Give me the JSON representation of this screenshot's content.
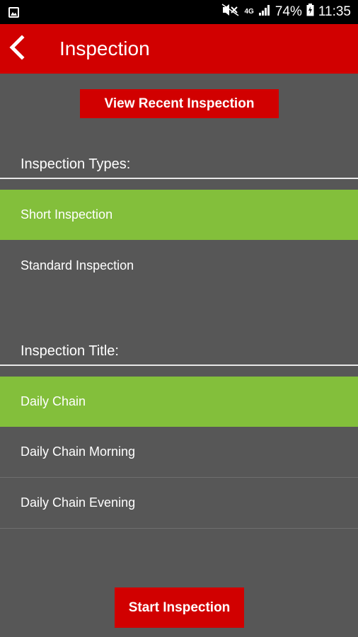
{
  "status_bar": {
    "network_label": "4G",
    "battery": "74%",
    "time": "11:35",
    "icons": [
      "gallery-notification-icon",
      "mute-icon",
      "signal-icon",
      "battery-icon"
    ]
  },
  "app_bar": {
    "title": "Inspection",
    "back_icon": "chevron-left-icon",
    "color": "#d10000"
  },
  "recent_button": {
    "label": "View Recent Inspection"
  },
  "inspection_types": {
    "label": "Inspection Types:",
    "items": [
      {
        "label": "Short Inspection",
        "selected": true
      },
      {
        "label": "Standard Inspection",
        "selected": false
      }
    ]
  },
  "inspection_titles": {
    "label": "Inspection Title:",
    "items": [
      {
        "label": "Daily Chain",
        "selected": true
      },
      {
        "label": "Daily Chain Morning",
        "selected": false
      },
      {
        "label": "Daily Chain Evening",
        "selected": false
      }
    ]
  },
  "start_button": {
    "label": "Start Inspection"
  },
  "colors": {
    "accent_red": "#d10000",
    "selected_green": "#83bf3b",
    "background": "#575757"
  }
}
